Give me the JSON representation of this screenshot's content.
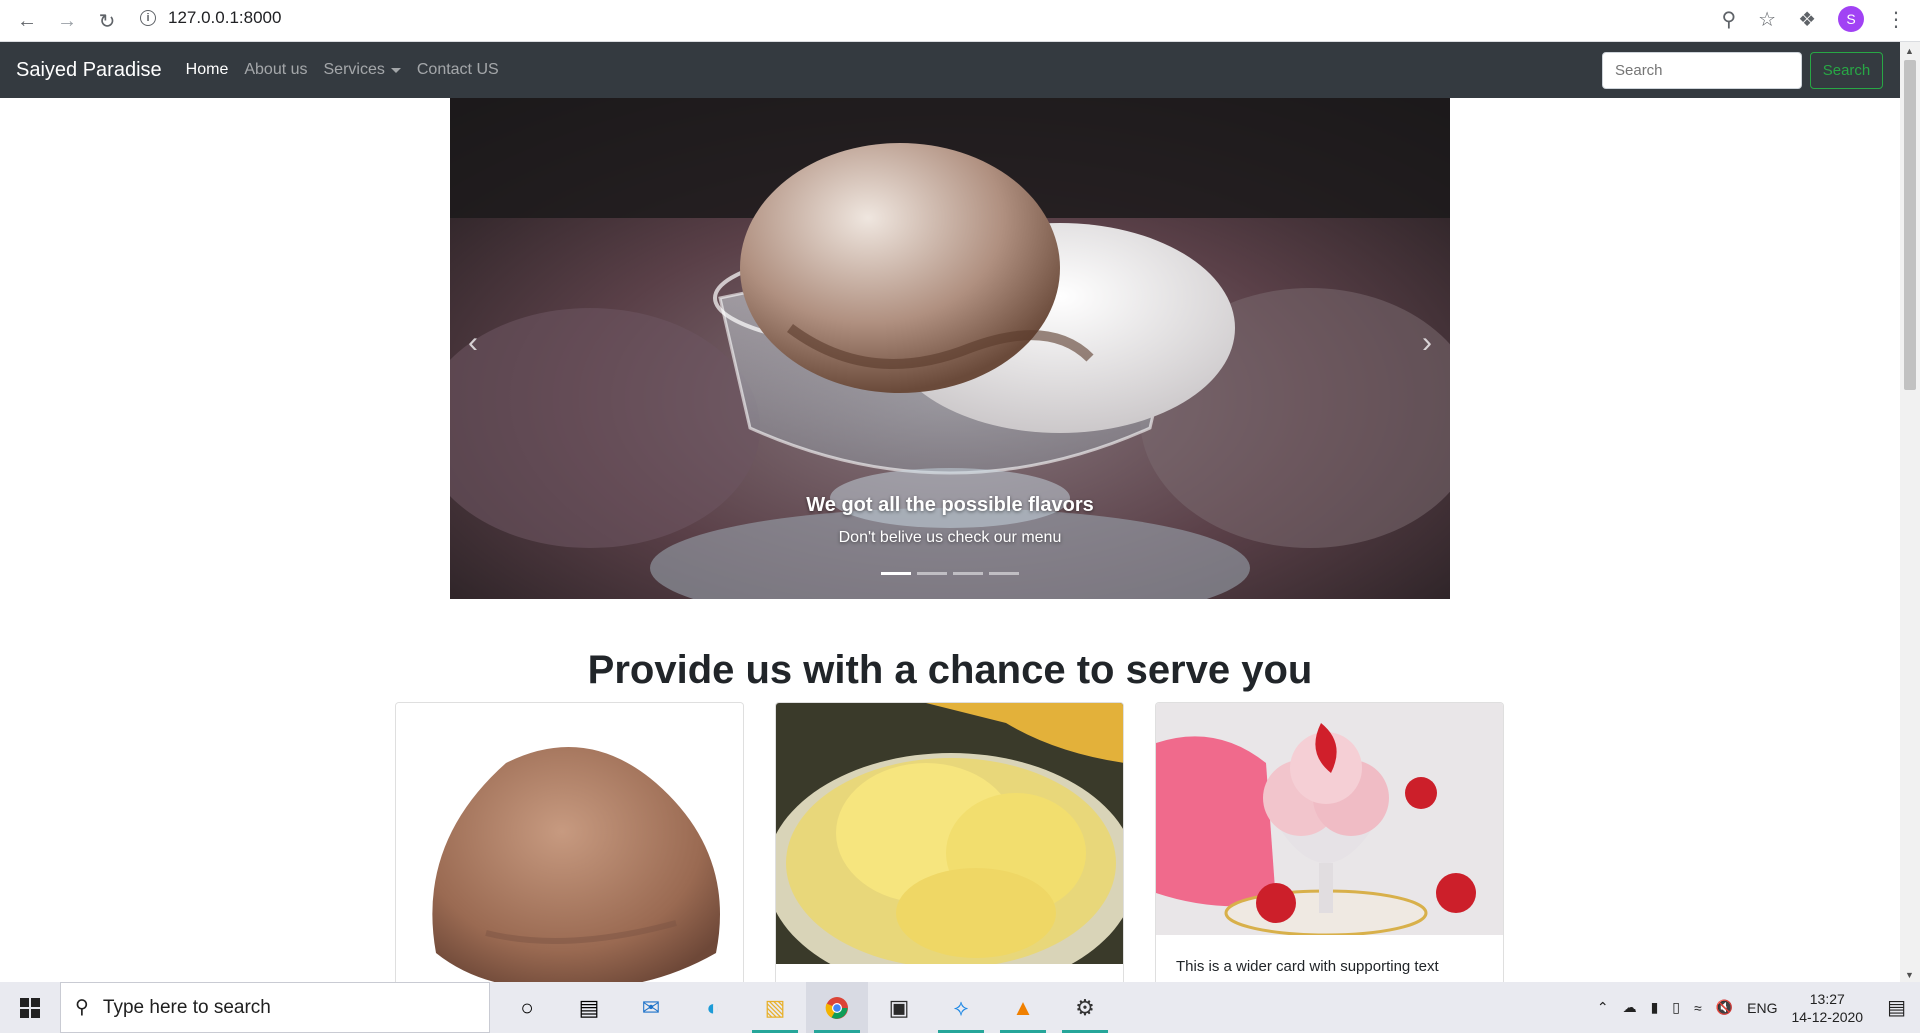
{
  "browser": {
    "url": "127.0.0.1:8000",
    "profile_initial": "S"
  },
  "navbar": {
    "brand": "Saiyed Paradise",
    "links": [
      "Home",
      "About us",
      "Services",
      "Contact US"
    ],
    "search_placeholder": "Search",
    "search_button": "Search"
  },
  "carousel": {
    "caption_title": "We got all the possible flavors",
    "caption_text": "Don't belive us check our menu",
    "slide_count": 4,
    "active_slide": 1
  },
  "section": {
    "title": "Provide us with a chance to serve you"
  },
  "cards": [
    {
      "text": ""
    },
    {
      "text": ""
    },
    {
      "text": "This is a wider card with supporting text"
    }
  ],
  "taskbar": {
    "search_placeholder": "Type here to search",
    "language": "ENG",
    "time": "13:27",
    "date": "14-12-2020"
  },
  "colors": {
    "navbar_bg": "#343a40",
    "success": "#28a745"
  }
}
